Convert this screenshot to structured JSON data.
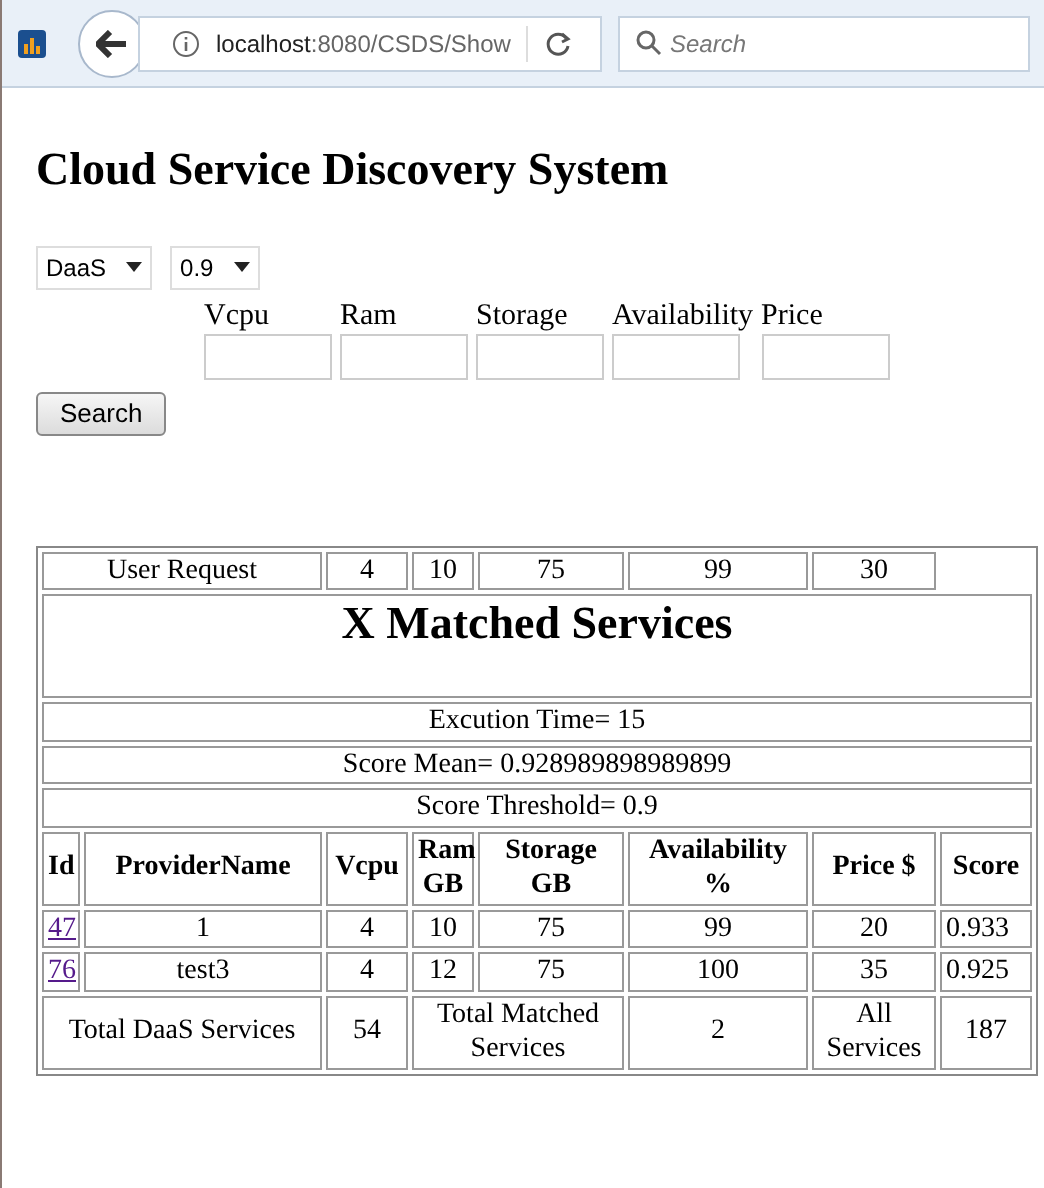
{
  "browser": {
    "url_host": "localhost",
    "url_rest": ":8080/CSDS/Show",
    "search_placeholder": "Search"
  },
  "heading": "Cloud Service Discovery System",
  "selects": [
    {
      "value": "DaaS"
    },
    {
      "value": "0.9"
    }
  ],
  "fields": [
    {
      "label": "Vcpu"
    },
    {
      "label": "Ram"
    },
    {
      "label": "Storage"
    },
    {
      "label": "Availability"
    },
    {
      "label": "Price"
    }
  ],
  "search_button": "Search",
  "table": {
    "request_row": {
      "label": "User Request",
      "values": [
        "4",
        "10",
        "75",
        "99",
        "30"
      ]
    },
    "title": "X Matched Services",
    "info_rows": [
      "Excution Time= 15",
      "Score Mean= 0.928989898989899",
      "Score Threshold= 0.9"
    ],
    "columns": [
      "Id",
      "ProviderName",
      "Vcpu",
      "Ram GB",
      "Storage GB",
      "Availability %",
      "Price $",
      "Score"
    ],
    "rows": [
      {
        "cells": [
          "47",
          "1",
          "4",
          "10",
          "75",
          "99",
          "20",
          "0.933"
        ]
      },
      {
        "cells": [
          "76",
          "test3",
          "4",
          "12",
          "75",
          "100",
          "35",
          "0.925"
        ]
      }
    ],
    "footer": [
      "Total DaaS Services",
      "54",
      "Total Matched Services",
      "2",
      "All Services",
      "187"
    ]
  }
}
